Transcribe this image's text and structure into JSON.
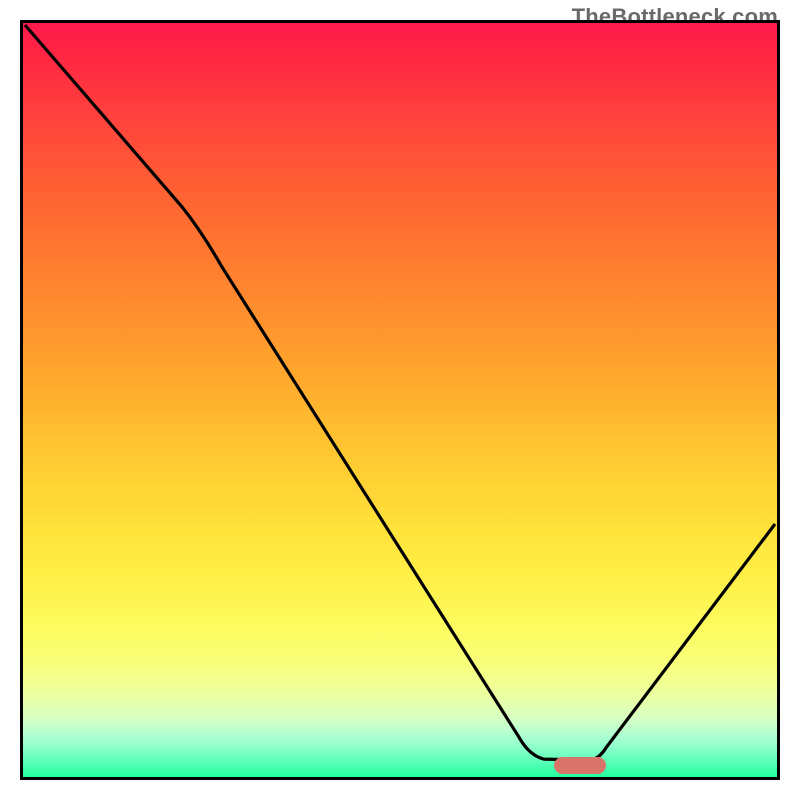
{
  "watermark": "TheBottleneck.com",
  "chart_data": {
    "type": "line",
    "title": "",
    "xlabel": "",
    "ylabel": "",
    "xlim": [
      0,
      100
    ],
    "ylim": [
      0,
      100
    ],
    "series": [
      {
        "name": "bottleneck-curve",
        "x": [
          0,
          20,
          66,
          71,
          76,
          100
        ],
        "y": [
          100,
          76,
          4,
          2,
          2,
          34
        ]
      }
    ],
    "gradient_stops": [
      {
        "pos": 0,
        "color": "#ff1a4d"
      },
      {
        "pos": 50,
        "color": "#ffb02e"
      },
      {
        "pos": 80,
        "color": "#fff95a"
      },
      {
        "pos": 100,
        "color": "#20ff9e"
      }
    ],
    "marker": {
      "x": 74,
      "y": 2,
      "color": "#d9746a"
    }
  }
}
